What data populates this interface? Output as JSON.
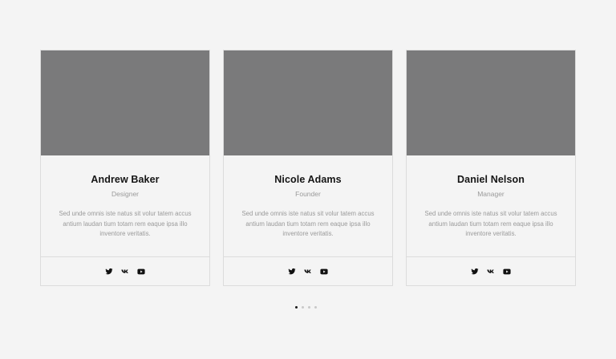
{
  "team": [
    {
      "name": "Andrew Baker",
      "role": "Designer",
      "description": "Sed unde omnis iste natus sit volur tatem accus antium laudan tium totam rem eaque ipsa illo inventore veritatis.",
      "social": [
        "twitter-icon",
        "vk-icon",
        "youtube-icon"
      ]
    },
    {
      "name": "Nicole Adams",
      "role": "Founder",
      "description": "Sed unde omnis iste natus sit volur tatem accus antium laudan tium totam rem eaque ipsa illo inventore veritatis.",
      "social": [
        "twitter-icon",
        "vk-icon",
        "youtube-icon"
      ]
    },
    {
      "name": "Daniel Nelson",
      "role": "Manager",
      "description": "Sed unde omnis iste natus sit volur tatem accus antium laudan tium totam rem eaque ipsa illo inventore veritatis.",
      "social": [
        "twitter-icon",
        "vk-icon",
        "youtube-icon"
      ]
    }
  ],
  "pagination": {
    "active_index": 0,
    "count": 4
  },
  "colors": {
    "background": "#f4f4f4",
    "photo_placeholder": "#7a7a7b",
    "name_text": "#141414",
    "muted_text": "#9a9a9a",
    "border": "#dcdcdc",
    "dot_active": "#1a1a1a",
    "dot_inactive": "#c9c9c9"
  }
}
